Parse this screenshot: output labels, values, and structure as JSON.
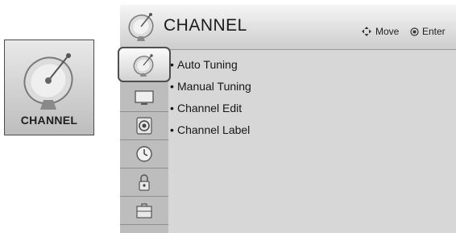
{
  "tile": {
    "label": "CHANNEL",
    "icon": "satellite-dish-icon"
  },
  "header": {
    "title": "CHANNEL",
    "icon": "satellite-dish-icon",
    "move_hint": "Move",
    "enter_hint": "Enter"
  },
  "sidebar": {
    "items": [
      {
        "icon": "satellite-dish-icon",
        "selected": true
      },
      {
        "icon": "monitor-icon"
      },
      {
        "icon": "speaker-icon"
      },
      {
        "icon": "clock-icon"
      },
      {
        "icon": "lock-icon"
      },
      {
        "icon": "toolbox-icon"
      }
    ]
  },
  "menu": {
    "items": [
      {
        "label": "Auto Tuning"
      },
      {
        "label": "Manual Tuning"
      },
      {
        "label": "Channel Edit"
      },
      {
        "label": "Channel Label"
      }
    ]
  }
}
